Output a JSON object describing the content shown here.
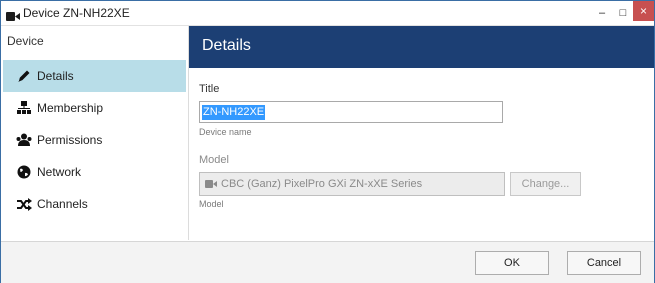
{
  "window": {
    "title": "Device ZN-NH22XE",
    "app_icon": "camera-icon",
    "controls": {
      "minimize": "–",
      "maximize": "□",
      "close": "×"
    }
  },
  "sidebar": {
    "header": "Device",
    "items": [
      {
        "label": "Details",
        "icon": "pencil-icon",
        "active": true
      },
      {
        "label": "Membership",
        "icon": "hierarchy-icon",
        "active": false
      },
      {
        "label": "Permissions",
        "icon": "users-icon",
        "active": false
      },
      {
        "label": "Network",
        "icon": "globe-icon",
        "active": false
      },
      {
        "label": "Channels",
        "icon": "shuffle-icon",
        "active": false
      }
    ]
  },
  "content": {
    "header": "Details",
    "title_field": {
      "label": "Title",
      "value": "ZN-NH22XE",
      "hint": "Device name"
    },
    "model_field": {
      "label": "Model",
      "value": "CBC (Ganz) PixelPro GXi ZN-xXE Series",
      "hint": "Model",
      "button": "Change..."
    }
  },
  "footer": {
    "ok": "OK",
    "cancel": "Cancel"
  },
  "colors": {
    "header_bg": "#1c3f74",
    "active_item_bg": "#b8dde8",
    "selection": "#3399ff",
    "close_button": "#c75050"
  }
}
